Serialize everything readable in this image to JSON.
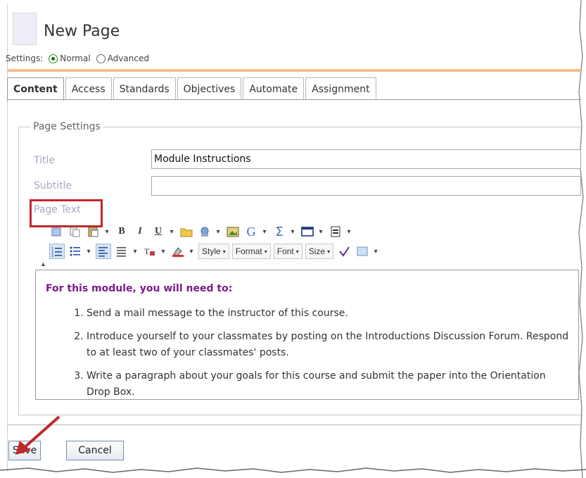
{
  "page": {
    "title": "New Page"
  },
  "settings": {
    "label": "Settings:",
    "options": [
      "Normal",
      "Advanced"
    ],
    "selected": "Normal"
  },
  "tabs": [
    {
      "label": "Content",
      "active": true
    },
    {
      "label": "Access",
      "active": false
    },
    {
      "label": "Standards",
      "active": false
    },
    {
      "label": "Objectives",
      "active": false
    },
    {
      "label": "Automate",
      "active": false
    },
    {
      "label": "Assignment",
      "active": false
    }
  ],
  "page_settings": {
    "legend": "Page Settings",
    "title_label": "Title",
    "title_value": "Module Instructions",
    "subtitle_label": "Subtitle",
    "subtitle_value": "",
    "page_text_label": "Page Text"
  },
  "toolbar": {
    "row2_dropdowns": [
      "Style",
      "Format",
      "Font",
      "Size"
    ]
  },
  "editor": {
    "heading": "For this module, you will need to:",
    "items": [
      "Send a mail message to the instructor of this course.",
      "Introduce yourself to your classmates by posting on the Introductions Discussion Forum.  Respond to at least two of your classmates' posts.",
      "Write a paragraph about your goals for this course and submit the paper into the Orientation Drop Box."
    ]
  },
  "buttons": {
    "save": "Save",
    "cancel": "Cancel"
  },
  "colors": {
    "heading_purple": "#7a1a8a",
    "highlight_red": "#c0282c",
    "tab_accent": "#f2c38b"
  }
}
